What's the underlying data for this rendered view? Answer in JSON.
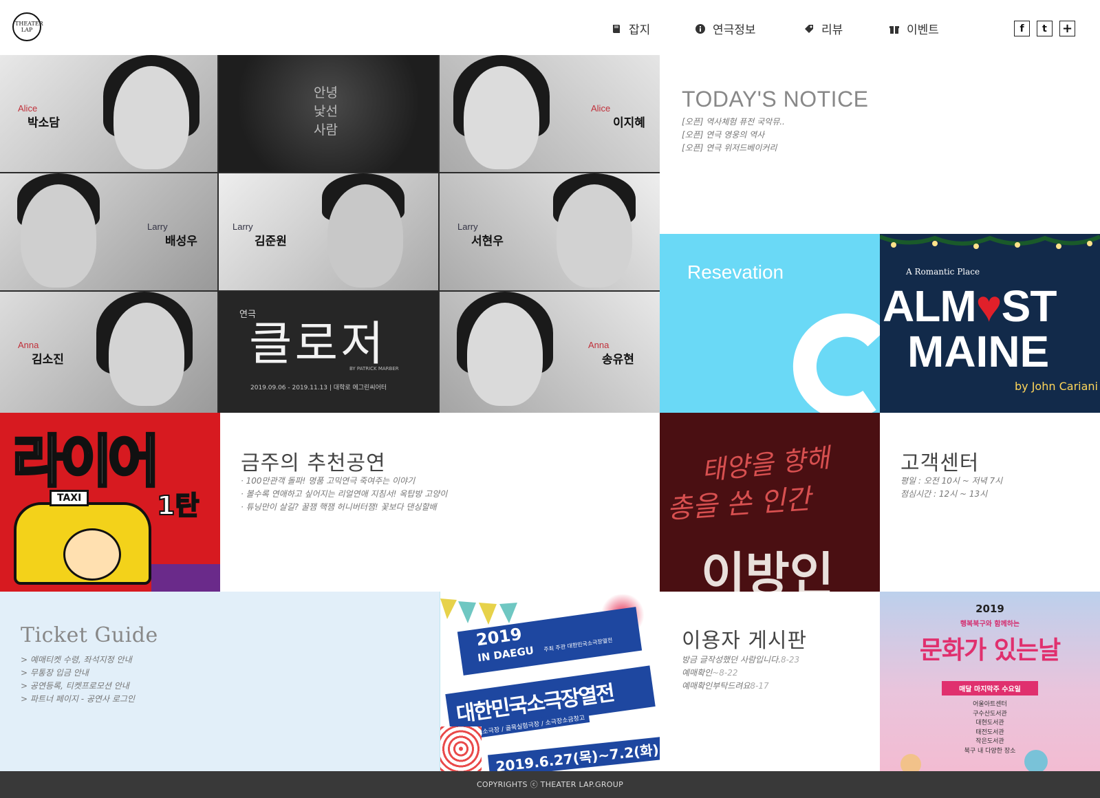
{
  "header": {
    "logo_text": "THEATER LAP",
    "nav": [
      {
        "label": "잡지",
        "icon": "book-icon"
      },
      {
        "label": "연극정보",
        "icon": "info-icon"
      },
      {
        "label": "리뷰",
        "icon": "tag-icon"
      },
      {
        "label": "이벤트",
        "icon": "gift-icon"
      }
    ],
    "social": [
      {
        "label": "f",
        "icon": "facebook-icon"
      },
      {
        "label": "t",
        "icon": "twitter-icon"
      },
      {
        "label": "+",
        "icon": "plus-icon"
      }
    ]
  },
  "hero": {
    "center_top_text": [
      "안녕",
      "낯선",
      "사람"
    ],
    "cast": [
      {
        "role": "Alice",
        "name": "박소담"
      },
      {
        "role": "Alice",
        "name": "이지혜"
      },
      {
        "role": "Larry",
        "name": "배성우"
      },
      {
        "role": "Larry",
        "name": "김준원"
      },
      {
        "role": "Larry",
        "name": "서현우"
      },
      {
        "role": "Anna",
        "name": "김소진"
      },
      {
        "role": "Anna",
        "name": "송유현"
      }
    ],
    "play_prefix": "연극",
    "play_title": "클로저",
    "play_author": "BY PATRICK MARBER",
    "play_dates": "2019.09.06 - 2019.11.13 | 대학로 에그린씨어터"
  },
  "notice": {
    "title": "TODAY'S NOTICE",
    "items": [
      "[오픈] 역사체험 퓨전 국악뮤..",
      "[오픈] 연극 영웅의 역사",
      "[오픈] 연극 위저드베이커리"
    ]
  },
  "reservation": {
    "title": "Resevation"
  },
  "almost_maine": {
    "tagline": "A Romantic Place",
    "line1_a": "ALM",
    "line1_b": "ST",
    "line2": "MAINE",
    "author": "by John Cariani"
  },
  "liar": {
    "title": "라이어",
    "sub": "1탄",
    "sign": "TAXI"
  },
  "recommend": {
    "title": "금주의 추천공연",
    "items": [
      "· 100만관객 돌파! 명품 고믹연극 죽여주는 이야기",
      "· 볼수록 연애하고 싶어지는 리얼연애 지침서! 옥탑방 고양이",
      "· 튜닝만이 살길? 꿀잼 핵잼 허니버터잼! 꽃보다 댄싱할배"
    ]
  },
  "stranger": {
    "script1": "태양을 향해",
    "script2": "총을 쏜 인간",
    "title": "이방인"
  },
  "customer": {
    "title": "고객센터",
    "lines": [
      "평일 : 오전 10시 ~ 저녁 7시",
      "점심시간 : 12시 ~ 13시"
    ]
  },
  "ticket_guide": {
    "title": "Ticket Guide",
    "items": [
      "> 예매티켓 수령, 좌석지정 안내",
      "> 무통장 입금 안내",
      "> 공연등록, 티켓프로모션 안내",
      "> 파트너 페이지 - 공연사 로그인"
    ]
  },
  "festival": {
    "year": "2019",
    "city": "IN DAEGU",
    "host": "주최 주관 대한민국소극장열전",
    "title": "대한민국소극장열전",
    "venues": "한울림소극장 / 골목실험극장 / 소극장소금창고",
    "dates": "2019.6.27(목)~7.2(화)"
  },
  "board": {
    "title": "이용자 게시판",
    "items": [
      {
        "text": "방금 글작성했던 사람입니다.",
        "date": "8-23"
      },
      {
        "text": "예매확인",
        "date": "8-22"
      },
      {
        "text": "예매확인부탁드려요",
        "date": "8-17"
      }
    ]
  },
  "culture": {
    "year": "2019",
    "subtitle": "행복북구와 함께하는",
    "title": "문화가 있는날",
    "badge": "매달 마지막주 수요일",
    "venues": [
      "어울아트센터",
      "구수산도서관",
      "대현도서관",
      "태전도서관",
      "작은도서관",
      "북구 내 다양한 장소"
    ]
  },
  "footer": {
    "copyright": "COPYRIGHTS ⓒ THEATER LAP.GROUP"
  }
}
